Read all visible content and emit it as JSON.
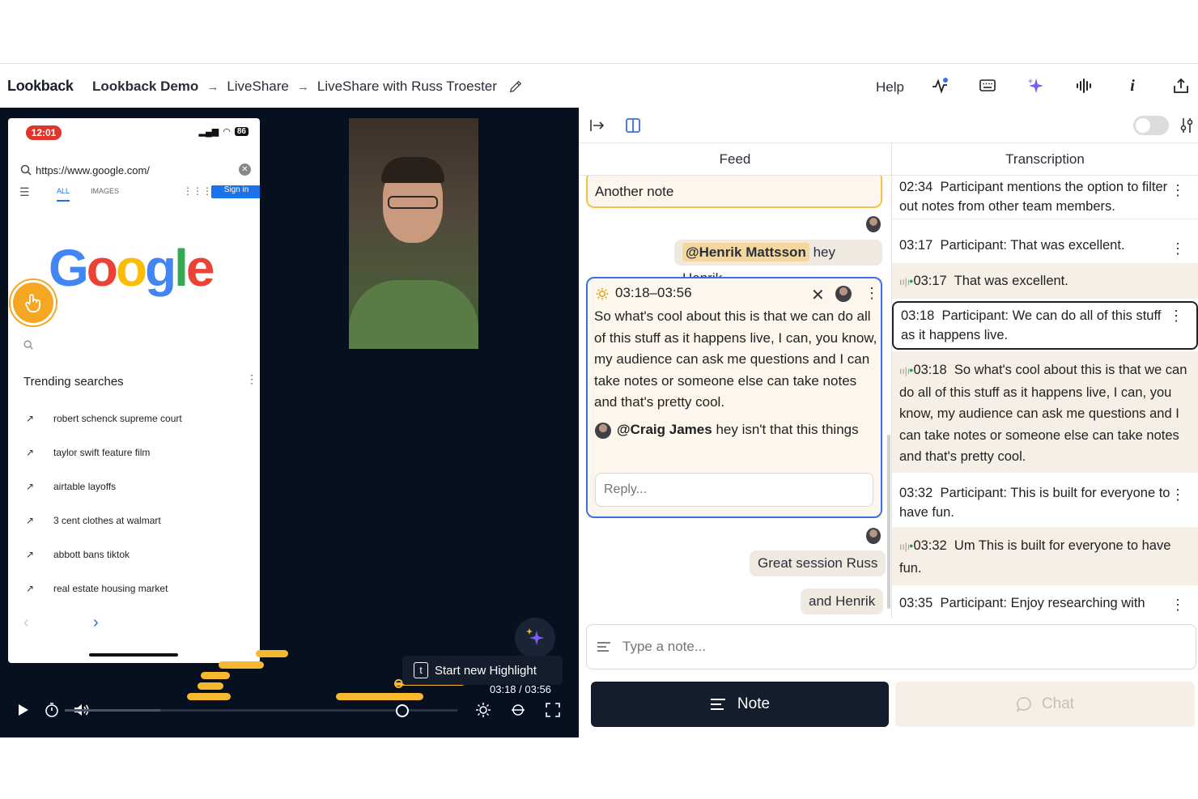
{
  "app": {
    "brand": "Lookback",
    "breadcrumb": [
      "Lookback Demo",
      "LiveShare",
      "LiveShare with Russ Troester"
    ],
    "help_label": "Help"
  },
  "phone": {
    "status_time": "12:01",
    "battery": "86",
    "url": "https://www.google.com/",
    "tab_all": "ALL",
    "tab_images": "IMAGES",
    "signin": "Sign in",
    "logo": "Google",
    "trending_title": "Trending searches",
    "trending": [
      "robert schenck supreme court",
      "taylor swift feature film",
      "airtable layoffs",
      "3 cent clothes at walmart",
      "abbott bans tiktok",
      "real estate housing market"
    ]
  },
  "player": {
    "highlight_key": "t",
    "highlight_label": "Start new Highlight",
    "timecode": "03:18 / 03:56",
    "progress_fraction": 0.84
  },
  "side": {
    "feed_label": "Feed",
    "transcription_label": "Transcription",
    "feed": {
      "note1": "Another note",
      "chat1_mention": "@Henrik Mattsson",
      "chat1_text": "hey Henrik",
      "note2_time": "03:18–03:56",
      "note2_body": "So what's cool about this is that we can do all of this stuff as it happens live, I can, you know, my audience can ask me questions and I can take notes or someone else can take notes and that's pretty cool.",
      "note2_reply_name": "@Craig James",
      "note2_reply_text": "hey isn't that this things",
      "reply_placeholder": "Reply...",
      "chat2": "Great session Russ",
      "chat3": "and Henrik"
    },
    "transcription": [
      {
        "time": "02:34",
        "text": "Participant mentions the option to filter out notes from other team members."
      },
      {
        "time": "03:17",
        "text": "Participant: That was excellent."
      },
      {
        "time": "03:17",
        "text": "That was excellent."
      },
      {
        "time": "03:18",
        "text": "Participant: We can do all of this stuff as it happens live."
      },
      {
        "time": "03:18",
        "text": "So what's cool about this is that we can do all of this stuff as it happens live, I can, you know, my audience can ask me questions and I can take notes or someone else can take notes and that's pretty cool."
      },
      {
        "time": "03:32",
        "text": "Participant: This is built for everyone to have fun."
      },
      {
        "time": "03:32",
        "text": "Um This is built for everyone to have fun."
      },
      {
        "time": "03:35",
        "text": "Participant: Enjoy researching with"
      }
    ],
    "composer_placeholder": "Type a note...",
    "note_button": "Note",
    "chat_button": "Chat"
  },
  "colors": {
    "accent_blue": "#3a6ee8",
    "highlight_yellow": "#f5b82e",
    "dark": "#141d2b"
  }
}
